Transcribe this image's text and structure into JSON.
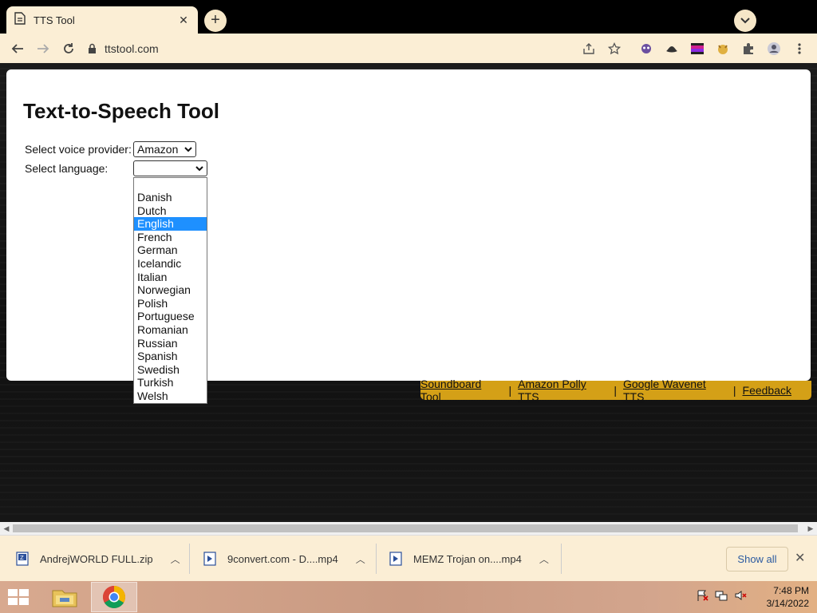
{
  "browser": {
    "tab_title": "TTS Tool",
    "url": "ttstool.com"
  },
  "page": {
    "title": "Text-to-Speech Tool",
    "provider_label": "Select voice provider:",
    "provider_value": "Amazon",
    "language_label": "Select language:",
    "language_value": "",
    "language_options": [
      "",
      "Danish",
      "Dutch",
      "English",
      "French",
      "German",
      "Icelandic",
      "Italian",
      "Norwegian",
      "Polish",
      "Portuguese",
      "Romanian",
      "Russian",
      "Spanish",
      "Swedish",
      "Turkish",
      "Welsh"
    ],
    "highlighted_option": "English",
    "footer_links": [
      "Soundboard Tool",
      "Amazon Polly TTS",
      "Google Wavenet TTS",
      "Feedback"
    ],
    "footer_separator": "|"
  },
  "downloads": {
    "items": [
      "AndrejWORLD FULL.zip",
      "9convert.com - D....mp4",
      "MEMZ Trojan on....mp4"
    ],
    "show_all": "Show all"
  },
  "taskbar": {
    "time": "7:48 PM",
    "date": "3/14/2022"
  },
  "colors": {
    "accent_selected": "#1e90ff",
    "footer_bg": "#d4a017",
    "chrome_bg": "#fbeed5"
  }
}
